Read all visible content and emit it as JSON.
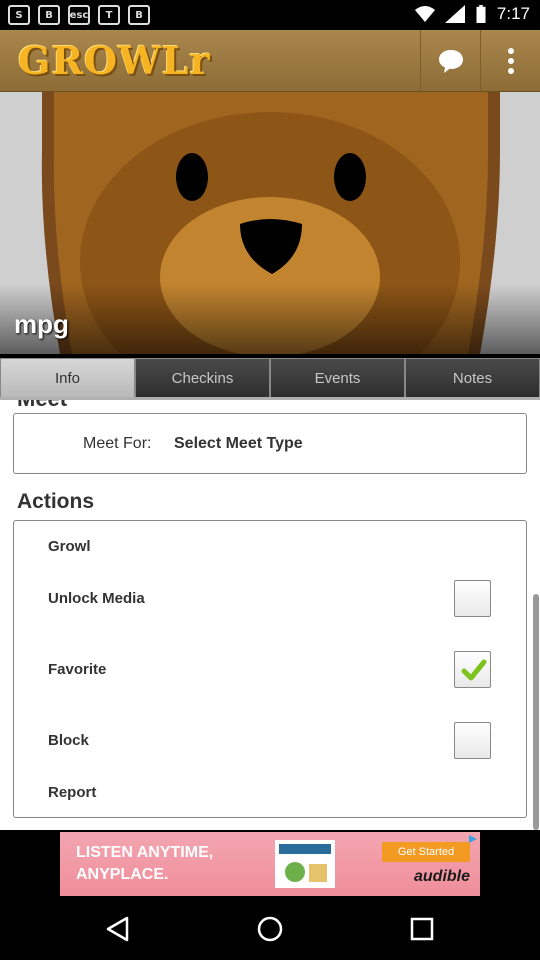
{
  "status_bar": {
    "time": "7:17",
    "notif_icons": [
      "S",
      "B",
      "esc",
      "T",
      "B"
    ]
  },
  "app_bar": {
    "logo": "GROWLr",
    "chat_icon": "chat-bubble-icon",
    "menu_icon": "overflow-menu-icon"
  },
  "profile": {
    "name": "mpg"
  },
  "tabs": [
    {
      "label": "Info",
      "active": true
    },
    {
      "label": "Checkins",
      "active": false
    },
    {
      "label": "Events",
      "active": false
    },
    {
      "label": "Notes",
      "active": false
    }
  ],
  "meet": {
    "section_title": "Meet",
    "label": "Meet For:",
    "value": "Select Meet Type"
  },
  "actions": {
    "title": "Actions",
    "items": [
      {
        "label": "Growl"
      },
      {
        "label": "Unlock Media",
        "checked": false
      },
      {
        "label": "Favorite",
        "checked": true
      },
      {
        "label": "Block",
        "checked": false
      },
      {
        "label": "Report"
      }
    ]
  },
  "ad": {
    "text": "LISTEN ANYTIME,\nANYPLACE.",
    "cta": "Get Started",
    "brand": "audible"
  },
  "colors": {
    "appbar": "#9c7b42",
    "logo": "#f6b423",
    "check": "#7dc21e"
  }
}
